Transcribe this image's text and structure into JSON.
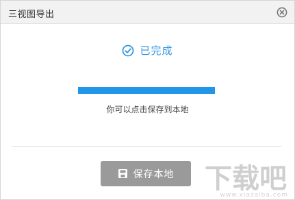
{
  "dialog": {
    "title": "三视图导出",
    "close_icon": "close-circle-icon"
  },
  "status": {
    "icon": "check-circle-icon",
    "text": "已完成",
    "color": "#2d94e0"
  },
  "progress": {
    "value": 1.0,
    "color": "#2196e8"
  },
  "hint": {
    "text": "你可以点击保存到本地"
  },
  "actions": {
    "save_label": "保存本地",
    "save_icon": "save-disk-icon",
    "button_color": "#9a9a9a"
  },
  "watermark": {
    "logo_text": "下载吧",
    "url_text": "www.xiazaiba.com"
  }
}
